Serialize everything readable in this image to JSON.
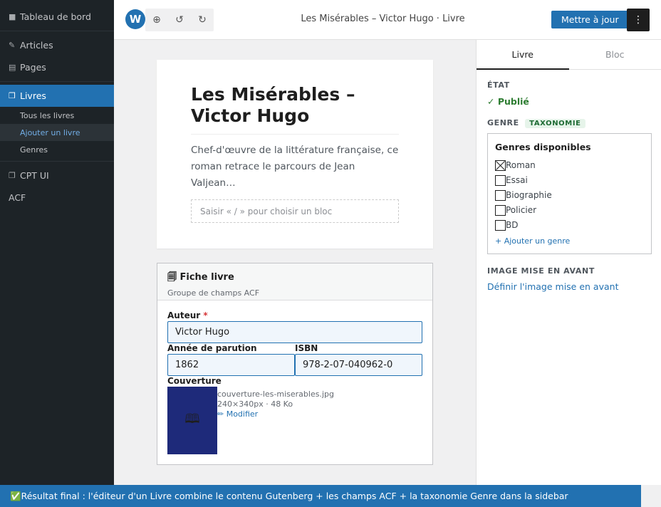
{
  "admin_menu": {
    "dashboard": "Tableau de bord",
    "articles": "Articles",
    "pages": "Pages",
    "livres": "Livres",
    "submenu": [
      "Tous les livres",
      "Ajouter un livre",
      "Genres"
    ],
    "cpt_ui": "CPT UI",
    "acf": "ACF",
    "icons": {
      "dashboard": "dashboard-icon",
      "articles": "articles-icon",
      "pages": "pages-icon",
      "livres": "book-icon",
      "cpt_ui": "cpt-icon"
    }
  },
  "toolbar": {
    "logo": "W",
    "insert_icon": "⊕",
    "undo_icon": "↺",
    "redo_icon": "↻",
    "doc_title": "Les Misérables – Victor Hugo · Livre",
    "update_label": "Mettre à jour",
    "more_icon": "⋮"
  },
  "post": {
    "title": "Les Misérables – Victor Hugo",
    "body": "Chef-d'œuvre de la littérature française, ce roman retrace le parcours de Jean Valjean…",
    "appender_placeholder": "Saisir « / » pour choisir un bloc"
  },
  "acf": {
    "title": "🗐 Fiche livre",
    "subtitle": "Groupe de champs ACF",
    "author_label": "Auteur",
    "required_mark": "*",
    "author_value": "Victor Hugo",
    "year_label": "Année de parution",
    "year_value": "1862",
    "isbn_label": "ISBN",
    "isbn_value": "978-2-07-040962-0",
    "cover_label": "Couverture",
    "cover_icon": "🕮",
    "cover_filename": "couverture-les-miserables.jpg",
    "cover_meta": "240×340px · 48 Ko",
    "cover_edit": "✏ Modifier"
  },
  "settings": {
    "tabs": [
      "Livre",
      "Bloc"
    ],
    "status_label": "ÉTAT",
    "status_value": "✓ Publié",
    "genre_label": "GENRE",
    "taxonomy_badge": "TAXONOMIE",
    "genres_title": "Genres disponibles",
    "genres": [
      {
        "label": "Roman",
        "checked": true
      },
      {
        "label": "Essai",
        "checked": false
      },
      {
        "label": "Biographie",
        "checked": false
      },
      {
        "label": "Policier",
        "checked": false
      },
      {
        "label": "BD",
        "checked": false
      }
    ],
    "add_genre": "+ Ajouter un genre",
    "featured_label": "IMAGE MISE EN AVANT",
    "featured_link": "Définir l'image mise en avant"
  },
  "banner": "✅Résultat final : l'éditeur d'un Livre combine le contenu Gutenberg + les champs ACF + la taxonomie Genre dans la sidebar",
  "colors": {
    "accent": "#2271b1",
    "admin_bg": "#1d2327",
    "published": "#2e7d32"
  }
}
